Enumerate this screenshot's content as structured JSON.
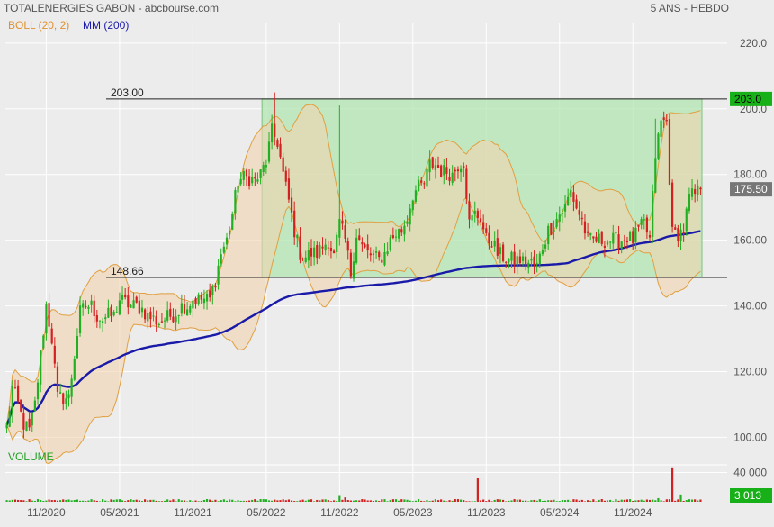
{
  "header": {
    "title": "TOTALENERGIES GABON - abcbourse.com",
    "period": "5 ANS - HEBDO",
    "legend_boll": "BOLL (20, 2)",
    "legend_mm": "MM (200)",
    "volume_label": "VOLUME"
  },
  "colors": {
    "background": "#ececec",
    "grid": "#ffffff",
    "up": "#22b022",
    "down": "#d42020",
    "boll_fill": "#f2d4b0",
    "boll_line": "#e0a040",
    "ma_line": "#1a1aa8",
    "rect_fill": "#b2e6b2",
    "rect_stroke": "#80c080",
    "text": "#555555",
    "badge_green": "#18b018"
  },
  "chart_data": [
    {
      "type": "candlestick",
      "title": "TOTALENERGIES GABON",
      "period": "5 ANS - HEBDO",
      "ylim": [
        96,
        226
      ],
      "y_ticks": [
        "220.0",
        "200.0",
        "180.00",
        "160.00",
        "140.00",
        "120.00",
        "100.00"
      ],
      "y_tick_values": [
        220,
        200,
        180,
        160,
        140,
        120,
        100
      ],
      "x_ticks": [
        "11/2020",
        "05/2021",
        "11/2021",
        "05/2022",
        "11/2022",
        "05/2023",
        "11/2023",
        "05/2024",
        "11/2024"
      ],
      "x_tick_index": [
        14,
        40,
        66,
        92,
        118,
        144,
        170,
        196,
        222
      ],
      "n_weeks": 247,
      "close_anchors": [
        [
          0,
          103
        ],
        [
          2,
          115
        ],
        [
          4,
          110
        ],
        [
          6,
          104
        ],
        [
          8,
          102
        ],
        [
          10,
          110
        ],
        [
          12,
          125
        ],
        [
          14,
          140
        ],
        [
          16,
          130
        ],
        [
          18,
          112
        ],
        [
          20,
          112
        ],
        [
          22,
          112
        ],
        [
          24,
          125
        ],
        [
          26,
          138
        ],
        [
          28,
          140
        ],
        [
          30,
          140
        ],
        [
          32,
          137
        ],
        [
          34,
          136
        ],
        [
          36,
          137
        ],
        [
          38,
          137
        ],
        [
          40,
          142
        ],
        [
          42,
          141
        ],
        [
          44,
          140
        ],
        [
          46,
          140
        ],
        [
          48,
          139
        ],
        [
          50,
          137
        ],
        [
          52,
          136
        ],
        [
          54,
          135
        ],
        [
          56,
          136
        ],
        [
          58,
          137
        ],
        [
          60,
          138
        ],
        [
          62,
          140
        ],
        [
          64,
          140
        ],
        [
          66,
          142
        ],
        [
          68,
          142
        ],
        [
          70,
          142
        ],
        [
          72,
          142
        ],
        [
          74,
          148
        ],
        [
          76,
          156
        ],
        [
          78,
          160
        ],
        [
          80,
          168
        ],
        [
          82,
          178
        ],
        [
          84,
          179
        ],
        [
          86,
          179
        ],
        [
          88,
          178
        ],
        [
          90,
          180
        ],
        [
          92,
          184
        ],
        [
          94,
          193
        ],
        [
          96,
          190
        ],
        [
          98,
          180
        ],
        [
          100,
          172
        ],
        [
          102,
          163
        ],
        [
          104,
          156
        ],
        [
          106,
          155
        ],
        [
          108,
          156
        ],
        [
          110,
          156
        ],
        [
          112,
          158
        ],
        [
          114,
          160
        ],
        [
          116,
          155
        ],
        [
          118,
          165
        ],
        [
          120,
          160
        ],
        [
          122,
          150
        ],
        [
          124,
          162
        ],
        [
          126,
          158
        ],
        [
          128,
          156
        ],
        [
          130,
          155
        ],
        [
          132,
          154
        ],
        [
          134,
          156
        ],
        [
          136,
          160
        ],
        [
          138,
          162
        ],
        [
          140,
          163
        ],
        [
          142,
          167
        ],
        [
          144,
          174
        ],
        [
          146,
          176
        ],
        [
          148,
          177
        ],
        [
          150,
          183
        ],
        [
          152,
          183
        ],
        [
          154,
          181
        ],
        [
          156,
          181
        ],
        [
          158,
          180
        ],
        [
          160,
          183
        ],
        [
          162,
          184
        ],
        [
          164,
          165
        ],
        [
          166,
          168
        ],
        [
          168,
          167
        ],
        [
          170,
          160
        ],
        [
          172,
          160
        ],
        [
          174,
          156
        ],
        [
          176,
          155
        ],
        [
          178,
          154
        ],
        [
          180,
          154
        ],
        [
          182,
          154
        ],
        [
          184,
          153
        ],
        [
          186,
          153
        ],
        [
          188,
          152
        ],
        [
          190,
          158
        ],
        [
          192,
          163
        ],
        [
          194,
          165
        ],
        [
          196,
          168
        ],
        [
          198,
          170
        ],
        [
          200,
          175
        ],
        [
          202,
          170
        ],
        [
          204,
          166
        ],
        [
          206,
          160
        ],
        [
          208,
          160
        ],
        [
          210,
          160
        ],
        [
          212,
          160
        ],
        [
          214,
          160
        ],
        [
          216,
          160
        ],
        [
          218,
          160
        ],
        [
          220,
          161
        ],
        [
          222,
          160
        ],
        [
          224,
          163
        ],
        [
          226,
          165
        ],
        [
          228,
          160
        ],
        [
          230,
          186
        ],
        [
          232,
          196
        ],
        [
          234,
          196
        ],
        [
          236,
          162
        ],
        [
          238,
          162
        ],
        [
          240,
          163
        ],
        [
          242,
          173
        ],
        [
          244,
          174
        ],
        [
          246,
          175.5
        ]
      ],
      "spikes": [
        [
          118,
          201
        ],
        [
          95,
          205
        ],
        [
          230,
          197
        ],
        [
          163,
          168
        ]
      ],
      "volume": {
        "label": "VOLUME",
        "ylim": [
          0,
          48000
        ],
        "y_tick": "40 000",
        "y_tick_value": 40000,
        "base_level": 2000,
        "last": "3 013",
        "spikes": [
          [
            118,
            8000
          ],
          [
            120,
            6000
          ],
          [
            167,
            32000
          ],
          [
            231,
            5000
          ],
          [
            236,
            47000
          ],
          [
            239,
            10000
          ]
        ]
      },
      "annotations": {
        "resistance": {
          "label": "203.00",
          "value": 203
        },
        "support": {
          "label": "148.66",
          "value": 148.66
        },
        "range_box": {
          "start_index": 91,
          "end_index": 247,
          "from": 148.66,
          "to": 203
        }
      },
      "badges": {
        "resistance": "203.0",
        "last_price": "175.50",
        "volume_last": "3 013"
      },
      "series": [
        {
          "name": "BOLL (20, 2)",
          "window": 20,
          "k": 2
        },
        {
          "name": "MM (200)",
          "window": 200
        }
      ],
      "grid": true
    }
  ]
}
